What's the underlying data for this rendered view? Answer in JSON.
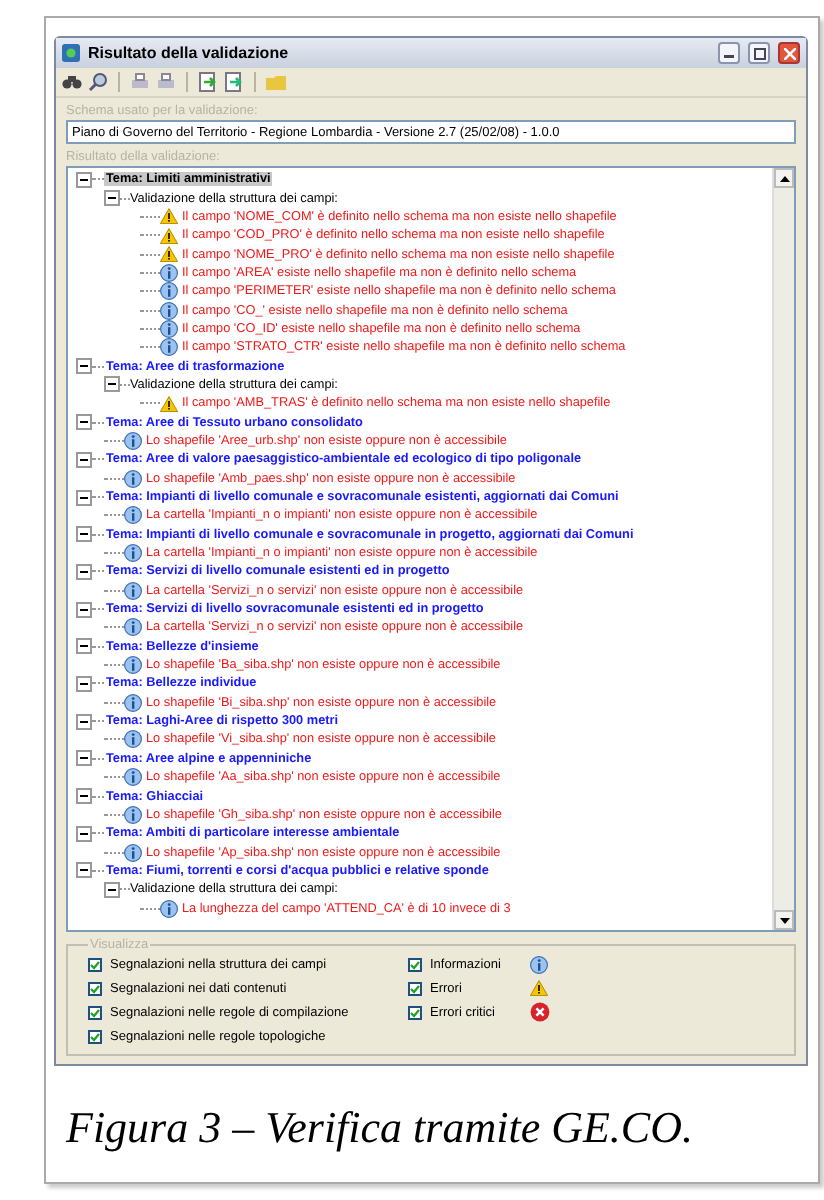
{
  "window": {
    "title": "Risultato della validazione"
  },
  "schema": {
    "label": "Schema usato per la validazione:",
    "value": "Piano di Governo del Territorio - Regione Lombardia - Versione 2.7 (25/02/08) - 1.0.0"
  },
  "result_label": "Risultato della validazione:",
  "tree": [
    {
      "label": "Tema: Limiti amministrativi",
      "selected": true,
      "expanded": true,
      "children": [
        {
          "kind": "group",
          "label": "Validazione della struttura dei campi:",
          "expanded": true,
          "children": [
            {
              "kind": "warning",
              "label": "Il campo 'NOME_COM' è definito nello schema ma non esiste nello shapefile"
            },
            {
              "kind": "warning",
              "label": "Il campo 'COD_PRO' è definito nello schema ma non esiste nello shapefile"
            },
            {
              "kind": "warning",
              "label": "Il campo 'NOME_PRO' è definito nello schema ma non esiste nello shapefile"
            },
            {
              "kind": "info",
              "label": "Il campo 'AREA' esiste nello shapefile ma non è definito nello schema"
            },
            {
              "kind": "info",
              "label": "Il campo 'PERIMETER' esiste nello shapefile ma non è definito nello schema"
            },
            {
              "kind": "info",
              "label": "Il campo 'CO_' esiste nello shapefile ma non è definito nello schema"
            },
            {
              "kind": "info",
              "label": "Il campo 'CO_ID' esiste nello shapefile ma non è definito nello schema"
            },
            {
              "kind": "info",
              "label": "Il campo 'STRATO_CTR' esiste nello shapefile ma non è definito nello schema"
            }
          ]
        }
      ]
    },
    {
      "label": "Tema: Aree di trasformazione",
      "selected": false,
      "expanded": true,
      "children": [
        {
          "kind": "group",
          "label": "Validazione della struttura dei campi:",
          "expanded": true,
          "children": [
            {
              "kind": "warning",
              "label": "Il campo 'AMB_TRAS' è definito nello schema ma non esiste nello shapefile"
            }
          ]
        }
      ]
    },
    {
      "label": "Tema: Aree di Tessuto urbano consolidato",
      "selected": false,
      "expanded": true,
      "children": [
        {
          "kind": "info",
          "label": "Lo shapefile 'Aree_urb.shp' non esiste oppure non è accessibile"
        }
      ]
    },
    {
      "label": "Tema: Aree di valore paesaggistico-ambientale ed ecologico di tipo poligonale",
      "selected": false,
      "expanded": true,
      "children": [
        {
          "kind": "info",
          "label": "Lo shapefile 'Amb_paes.shp' non esiste oppure non è accessibile"
        }
      ]
    },
    {
      "label": "Tema: Impianti di livello comunale e sovracomunale esistenti, aggiornati dai Comuni",
      "selected": false,
      "expanded": true,
      "children": [
        {
          "kind": "info",
          "label": "La cartella 'Impianti_n o impianti' non esiste oppure non è accessibile"
        }
      ]
    },
    {
      "label": "Tema: Impianti di livello comunale e sovracomunale in progetto, aggiornati dai Comuni",
      "selected": false,
      "expanded": true,
      "children": [
        {
          "kind": "info",
          "label": "La cartella 'Impianti_n o impianti' non esiste oppure non è accessibile"
        }
      ]
    },
    {
      "label": "Tema: Servizi di livello comunale esistenti ed in progetto",
      "selected": false,
      "expanded": true,
      "children": [
        {
          "kind": "info",
          "label": "La cartella 'Servizi_n o servizi' non esiste oppure non è accessibile"
        }
      ]
    },
    {
      "label": "Tema: Servizi di livello sovracomunale esistenti ed in progetto",
      "selected": false,
      "expanded": true,
      "children": [
        {
          "kind": "info",
          "label": "La cartella 'Servizi_n o servizi' non esiste oppure non è accessibile"
        }
      ]
    },
    {
      "label": "Tema: Bellezze d'insieme",
      "selected": false,
      "expanded": true,
      "children": [
        {
          "kind": "info",
          "label": "Lo shapefile 'Ba_siba.shp' non esiste oppure non è accessibile"
        }
      ]
    },
    {
      "label": "Tema: Bellezze individue",
      "selected": false,
      "expanded": true,
      "children": [
        {
          "kind": "info",
          "label": "Lo shapefile 'Bi_siba.shp' non esiste oppure non è accessibile"
        }
      ]
    },
    {
      "label": "Tema: Laghi-Aree di rispetto 300 metri",
      "selected": false,
      "expanded": true,
      "children": [
        {
          "kind": "info",
          "label": "Lo shapefile 'Vi_siba.shp' non esiste oppure non è accessibile"
        }
      ]
    },
    {
      "label": "Tema: Aree alpine e appenniniche",
      "selected": false,
      "expanded": true,
      "children": [
        {
          "kind": "info",
          "label": "Lo shapefile 'Aa_siba.shp' non esiste oppure non è accessibile"
        }
      ]
    },
    {
      "label": "Tema: Ghiacciai",
      "selected": false,
      "expanded": true,
      "children": [
        {
          "kind": "info",
          "label": "Lo shapefile 'Gh_siba.shp' non esiste oppure non è accessibile"
        }
      ]
    },
    {
      "label": "Tema: Ambiti di particolare interesse ambientale",
      "selected": false,
      "expanded": true,
      "children": [
        {
          "kind": "info",
          "label": "Lo shapefile 'Ap_siba.shp' non esiste oppure non è accessibile"
        }
      ]
    },
    {
      "label": "Tema: Fiumi, torrenti e corsi d'acqua pubblici e relative sponde",
      "selected": false,
      "expanded": true,
      "children": [
        {
          "kind": "group",
          "label": "Validazione della struttura dei campi:",
          "expanded": true,
          "children": [
            {
              "kind": "info",
              "label": "La lunghezza del campo 'ATTEND_CA' è di 10 invece di 3"
            }
          ]
        }
      ]
    }
  ],
  "filters": {
    "title": "Visualizza",
    "categories": [
      {
        "label": "Segnalazioni nella struttura dei campi",
        "checked": true
      },
      {
        "label": "Segnalazioni nei dati contenuti",
        "checked": true
      },
      {
        "label": "Segnalazioni nelle regole di compilazione",
        "checked": true
      },
      {
        "label": "Segnalazioni nelle regole topologiche",
        "checked": true
      }
    ],
    "levels": [
      {
        "label": "Informazioni",
        "checked": true,
        "kind": "info"
      },
      {
        "label": "Errori",
        "checked": true,
        "kind": "warning"
      },
      {
        "label": "Errori critici",
        "checked": true,
        "kind": "critical"
      }
    ]
  },
  "caption": "Figura 3 – Verifica tramite GE.CO."
}
